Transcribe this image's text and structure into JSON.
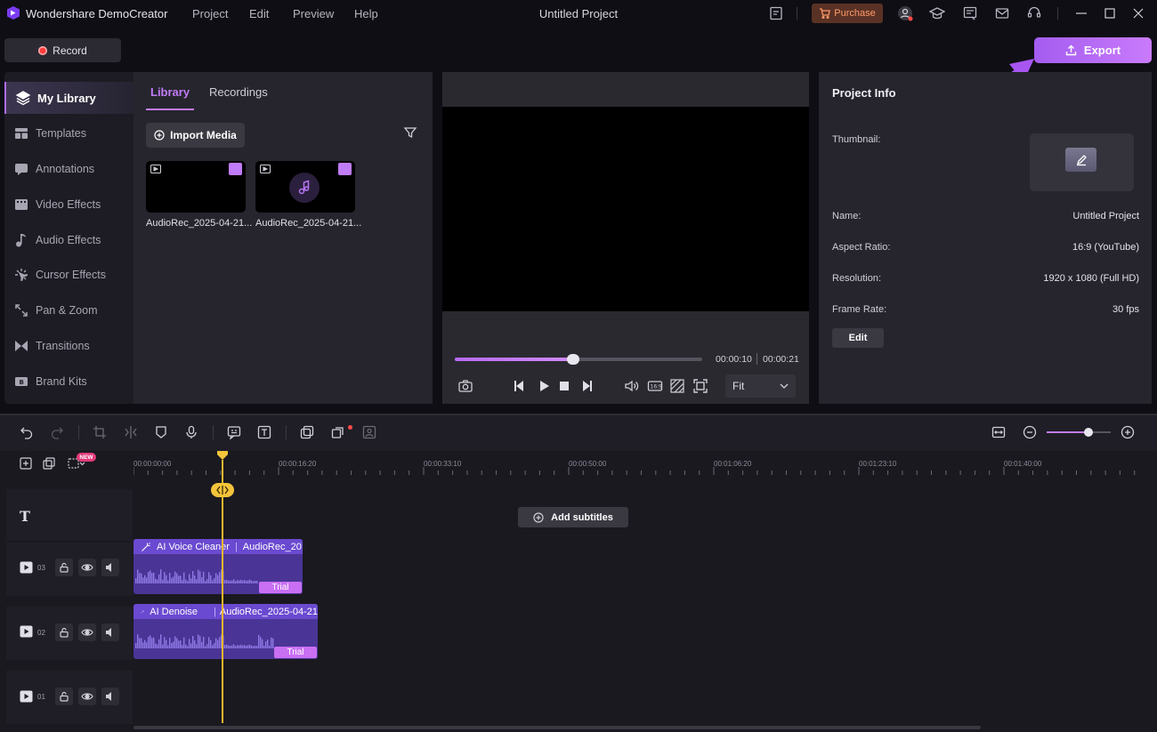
{
  "app": {
    "name": "Wondershare DemoCreator",
    "menu": [
      "Project",
      "Edit",
      "Preview",
      "Help"
    ],
    "window_title": "Untitled Project",
    "purchase_label": "Purchase"
  },
  "toolbar": {
    "record_label": "Record",
    "export_label": "Export"
  },
  "sidebar": {
    "items": [
      {
        "label": "My Library",
        "icon": "layers-icon",
        "active": true
      },
      {
        "label": "Templates",
        "icon": "template-icon"
      },
      {
        "label": "Annotations",
        "icon": "annotation-icon"
      },
      {
        "label": "Video Effects",
        "icon": "film-icon"
      },
      {
        "label": "Audio Effects",
        "icon": "music-note-icon"
      },
      {
        "label": "Cursor Effects",
        "icon": "cursor-sparkle-icon"
      },
      {
        "label": "Pan & Zoom",
        "icon": "pan-zoom-icon"
      },
      {
        "label": "Transitions",
        "icon": "transition-icon"
      },
      {
        "label": "Brand Kits",
        "icon": "brand-kit-icon"
      }
    ]
  },
  "library": {
    "tabs": [
      "Library",
      "Recordings"
    ],
    "import_label": "Import Media",
    "media": [
      {
        "name": "AudioRec_2025-04-21...",
        "type": "video"
      },
      {
        "name": "AudioRec_2025-04-21...",
        "type": "audio"
      }
    ]
  },
  "preview": {
    "progress": 0.48,
    "current_time": "00:00:10",
    "total_time": "00:00:21",
    "fit_label": "Fit"
  },
  "project_info": {
    "title": "Project Info",
    "thumbnail_label": "Thumbnail:",
    "fields": [
      {
        "label": "Name:",
        "value": "Untitled Project"
      },
      {
        "label": "Aspect Ratio:",
        "value": "16:9 (YouTube)"
      },
      {
        "label": "Resolution:",
        "value": "1920 x 1080 (Full HD)"
      },
      {
        "label": "Frame Rate:",
        "value": "30 fps"
      }
    ],
    "edit_label": "Edit"
  },
  "timeline": {
    "new_badge": "NEW",
    "ruler": [
      "00:00:00:00",
      "00:00:16:20",
      "00:00:33:10",
      "00:00:50:00",
      "00:01:06:20",
      "00:01:23:10",
      "00:01:40:00"
    ],
    "add_subtitles_label": "Add subtitles",
    "tracks": [
      {
        "number": "03",
        "clip_effect": "AI Voice Cleaner",
        "clip_name": "AudioRec_20",
        "badge": "Trial"
      },
      {
        "number": "02",
        "clip_effect": "AI Denoise",
        "clip_name": "AudioRec_2025-04-21",
        "badge": "Trial"
      },
      {
        "number": "01"
      }
    ],
    "zoom_level": 0.65
  },
  "colors": {
    "accent": "#c27cf8",
    "playhead": "#f4c43b",
    "clip": "#4a3596",
    "purchase": "#ff9a6a"
  }
}
